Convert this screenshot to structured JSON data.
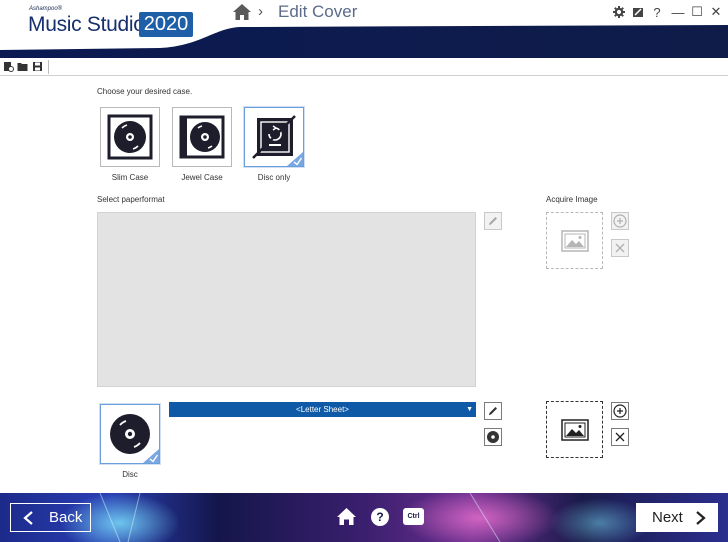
{
  "app": {
    "brand_small": "Ashampoo®",
    "brand_name": "Music Studio",
    "brand_year": "2020"
  },
  "breadcrumb": {
    "chevron": "›",
    "title": "Edit Cover"
  },
  "window_controls": [
    "gear-icon",
    "export-icon",
    "help-icon",
    "minimize-icon",
    "maximize-icon",
    "close-icon"
  ],
  "window_labels": {
    "help": "?",
    "minimize": "—",
    "maximize": "☐",
    "close": "✕"
  },
  "toolbar": {
    "items": [
      "new-project-icon",
      "open-folder-icon",
      "save-icon"
    ]
  },
  "case_section": {
    "heading": "Choose your desired case.",
    "options": [
      {
        "label": "Slim Case",
        "selected": false
      },
      {
        "label": "Jewel Case",
        "selected": false
      },
      {
        "label": "Disc only",
        "selected": true
      }
    ]
  },
  "paperformat": {
    "heading": "Select paperformat"
  },
  "acquire": {
    "heading": "Acquire Image"
  },
  "disc_section": {
    "label": "Disc",
    "sheet_value": "<Letter Sheet>"
  },
  "bottom_bar": {
    "back_label": "Back",
    "next_label": "Next",
    "ctrl_label": "Ctrl",
    "help_label": "?"
  },
  "colors": {
    "brand_blue": "#16306e",
    "accent_blue": "#0e5aa7",
    "selection_blue": "#6a9fdc",
    "bottom_bar_dark": "#1a1a4a"
  }
}
